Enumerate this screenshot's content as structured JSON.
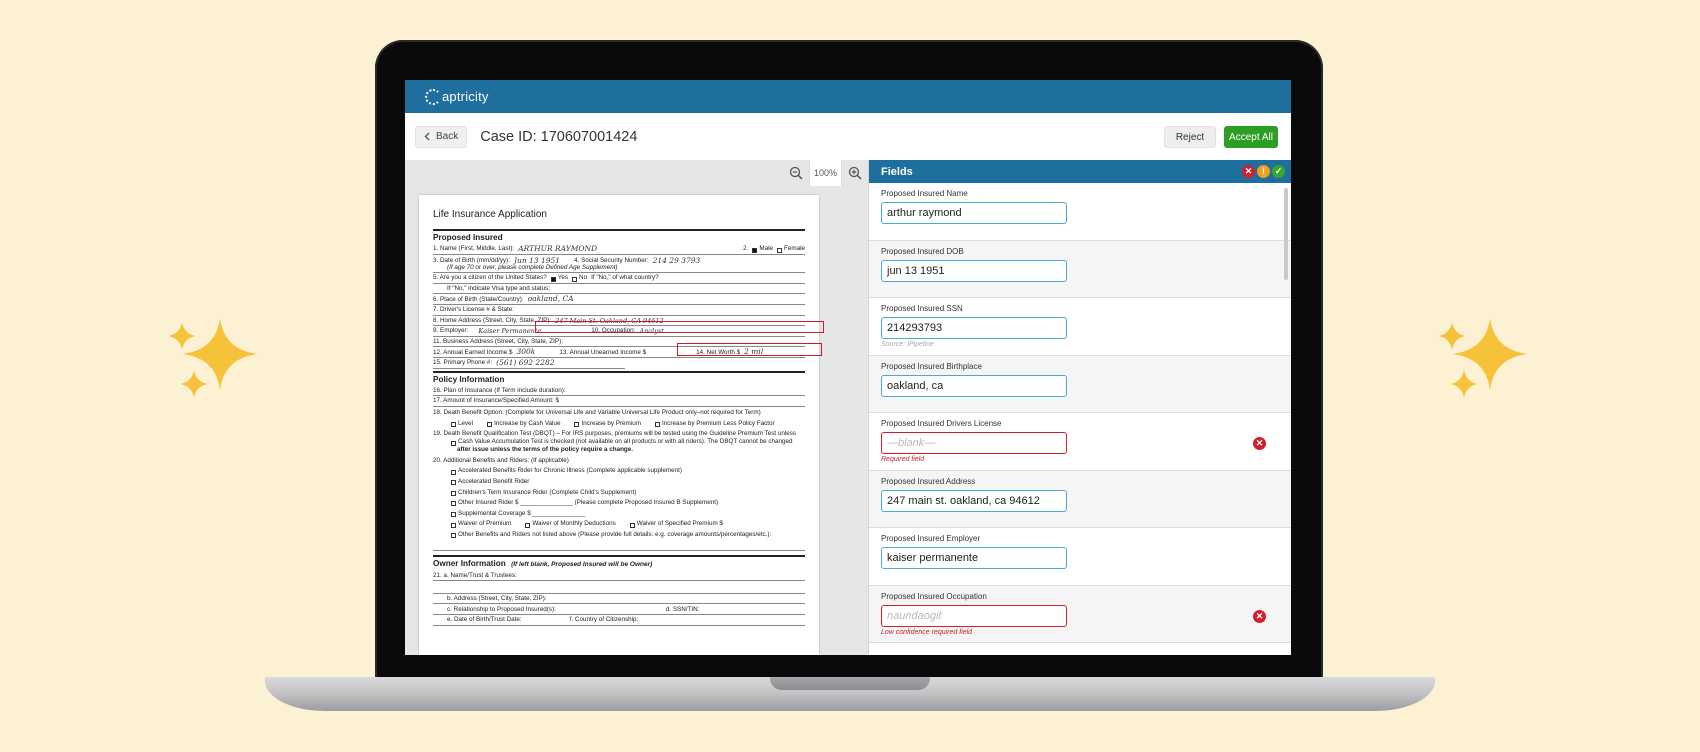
{
  "app": {
    "logo_text": "aptricity",
    "back_label": "Back",
    "case_title": "Case ID: 170607001424",
    "reject_label": "Reject",
    "accept_label": "Accept All",
    "zoom_level": "100%"
  },
  "document": {
    "title": "Life Insurance Application",
    "sections": {
      "insured": "Proposed Insured",
      "policy": "Policy Information",
      "owner": "Owner Information",
      "owner_note": "(If left blank, Proposed Insured will be Owner)"
    },
    "lines": {
      "l1": "1.   Name (First, Middle, Last):",
      "l1_hand": "ARTHUR   RAYMOND",
      "l1_right": "2.",
      "l1_male": "Male",
      "l1_female": "Female",
      "l3": "3.   Date of Birth (mm/dd/yy):",
      "l3_hand": "Jun 13  1951",
      "l3_right": "4.   Social Security Number:",
      "l3_ssn": "214 29 3793",
      "l3b": "(If age 70 or over, please complete Defined Age Supplement)",
      "l5": "5.   Are you a citizen of the United States?",
      "l5_yes": "Yes",
      "l5_no": "No",
      "l5_tail": "If \"No,\" of what country?",
      "l5b": "If \"No,\" indicate Visa type and status:",
      "l6": "6.   Place of Birth (State/Country):",
      "l6_hand": "oakland, CA",
      "l7": "7.   Driver's License # & State:",
      "l8": "8.   Home Address (Street, City, State, ZIP):",
      "l8_hand": "247 Main St. Oakland, CA 94612",
      "l9": "9.   Employer:",
      "l9_hand": "Kaiser Permanente",
      "l9_occ": "10. Occupation:",
      "l9_occ_hand": "Analyst",
      "l11": "11.  Business Address (Street, City, State, ZIP):",
      "l12": "12.  Annual Earned Income $",
      "l12_hand": "300k",
      "l12_mid": "13. Annual Unearned Income $",
      "l12_right": "14. Net Worth $",
      "l12_right_hand": "2 mil",
      "l15": "15.  Primary Phone #:",
      "l15_hand": "(561) 692 2282",
      "l16": "16.  Plan of Insurance (If Term include duration):",
      "l17": "17.  Amount of Insurance/Specified Amount:  $",
      "l18": "18.  Death Benefit Option: (Complete for Universal Life and Variable Universal Life Product only–not required for Term)",
      "l18_a": "Level",
      "l18_b": "Increase by Cash Value",
      "l18_c": "Increase by Premium",
      "l18_d": "Increase by Premium Less Policy Factor",
      "l19": "19.  Death Benefit Qualification Test (DBQT) – For IRS purposes, premiums will be tested using the Guideline Premium Test unless",
      "l19_a": "Cash Value Accumulation Test is checked (not available on all products or with all riders). The DBQT cannot be changed",
      "l19_b": "after issue unless the terms of the policy require a change.",
      "l20": "20.  Additional Benefits and Riders: (If applicable)",
      "r1": "Accelerated Benefits Rider for Chronic Illness (Complete applicable supplement)",
      "r2": "Accelerated Benefit Rider",
      "r3": "Children's Term Insurance Rider (Complete Child's Supplement)",
      "r4": "Other Insured Rider        $ _______________ (Please complete Proposed Insured B Supplement)",
      "r5": "Supplemental Coverage $ _______________",
      "r6": "Waiver of Premium",
      "r6b": "Waiver of Monthly Deductions",
      "r6c": "Waiver of Specified Premium  $",
      "r7": "Other Benefits and Riders not listed above (Please provide full details: e.g. coverage amounts/percentages/etc.):",
      "o21": "21.  a. Name/Trust & Trustees:",
      "o21b": "b. Address (Street, City, State, ZIP):",
      "o21c": "c. Relationship to Proposed Insured(s):",
      "o21c_r": "d. SSN/TIN:",
      "o21e": "e. Date of Birth/Trust Date:",
      "o21e_r": "f. Country of Citizenship:"
    }
  },
  "fields_panel": {
    "title": "Fields",
    "fields": [
      {
        "label": "Proposed Insured Name",
        "value": "arthur raymond",
        "note": ""
      },
      {
        "label": "Proposed Insured DOB",
        "value": "jun 13 1951",
        "note": ""
      },
      {
        "label": "Proposed Insured SSN",
        "value": "214293793",
        "note": "Source: IPipeline"
      },
      {
        "label": "Proposed Insured Birthplace",
        "value": "oakland, ca",
        "note": ""
      },
      {
        "label": "Proposed Insured Drivers License",
        "value": "—blank—",
        "note": "Required field"
      },
      {
        "label": "Proposed Insured Address",
        "value": "247 main st. oakland, ca 94612",
        "note": ""
      },
      {
        "label": "Proposed Insured Employer",
        "value": "kaiser permanente",
        "note": ""
      },
      {
        "label": "Proposed Insured Occupation",
        "value": "naundaogit",
        "note": "Low confidence required field"
      }
    ]
  },
  "colors": {
    "background": "#fdf1d3",
    "brand_blue": "#1e6e9e",
    "accept_green": "#2e9d23",
    "error_red": "#d0202e",
    "warning_orange": "#f0a01c",
    "sparkle_gold": "#f6c23a"
  },
  "icons": {
    "logo": "capricity-logo-icon",
    "back": "chevron-left-icon",
    "zoom_out": "zoom-out-icon",
    "zoom_in": "zoom-in-icon",
    "error": "error-x-icon",
    "warning": "warning-icon",
    "check": "check-icon",
    "sparkle": "sparkle-icon"
  }
}
